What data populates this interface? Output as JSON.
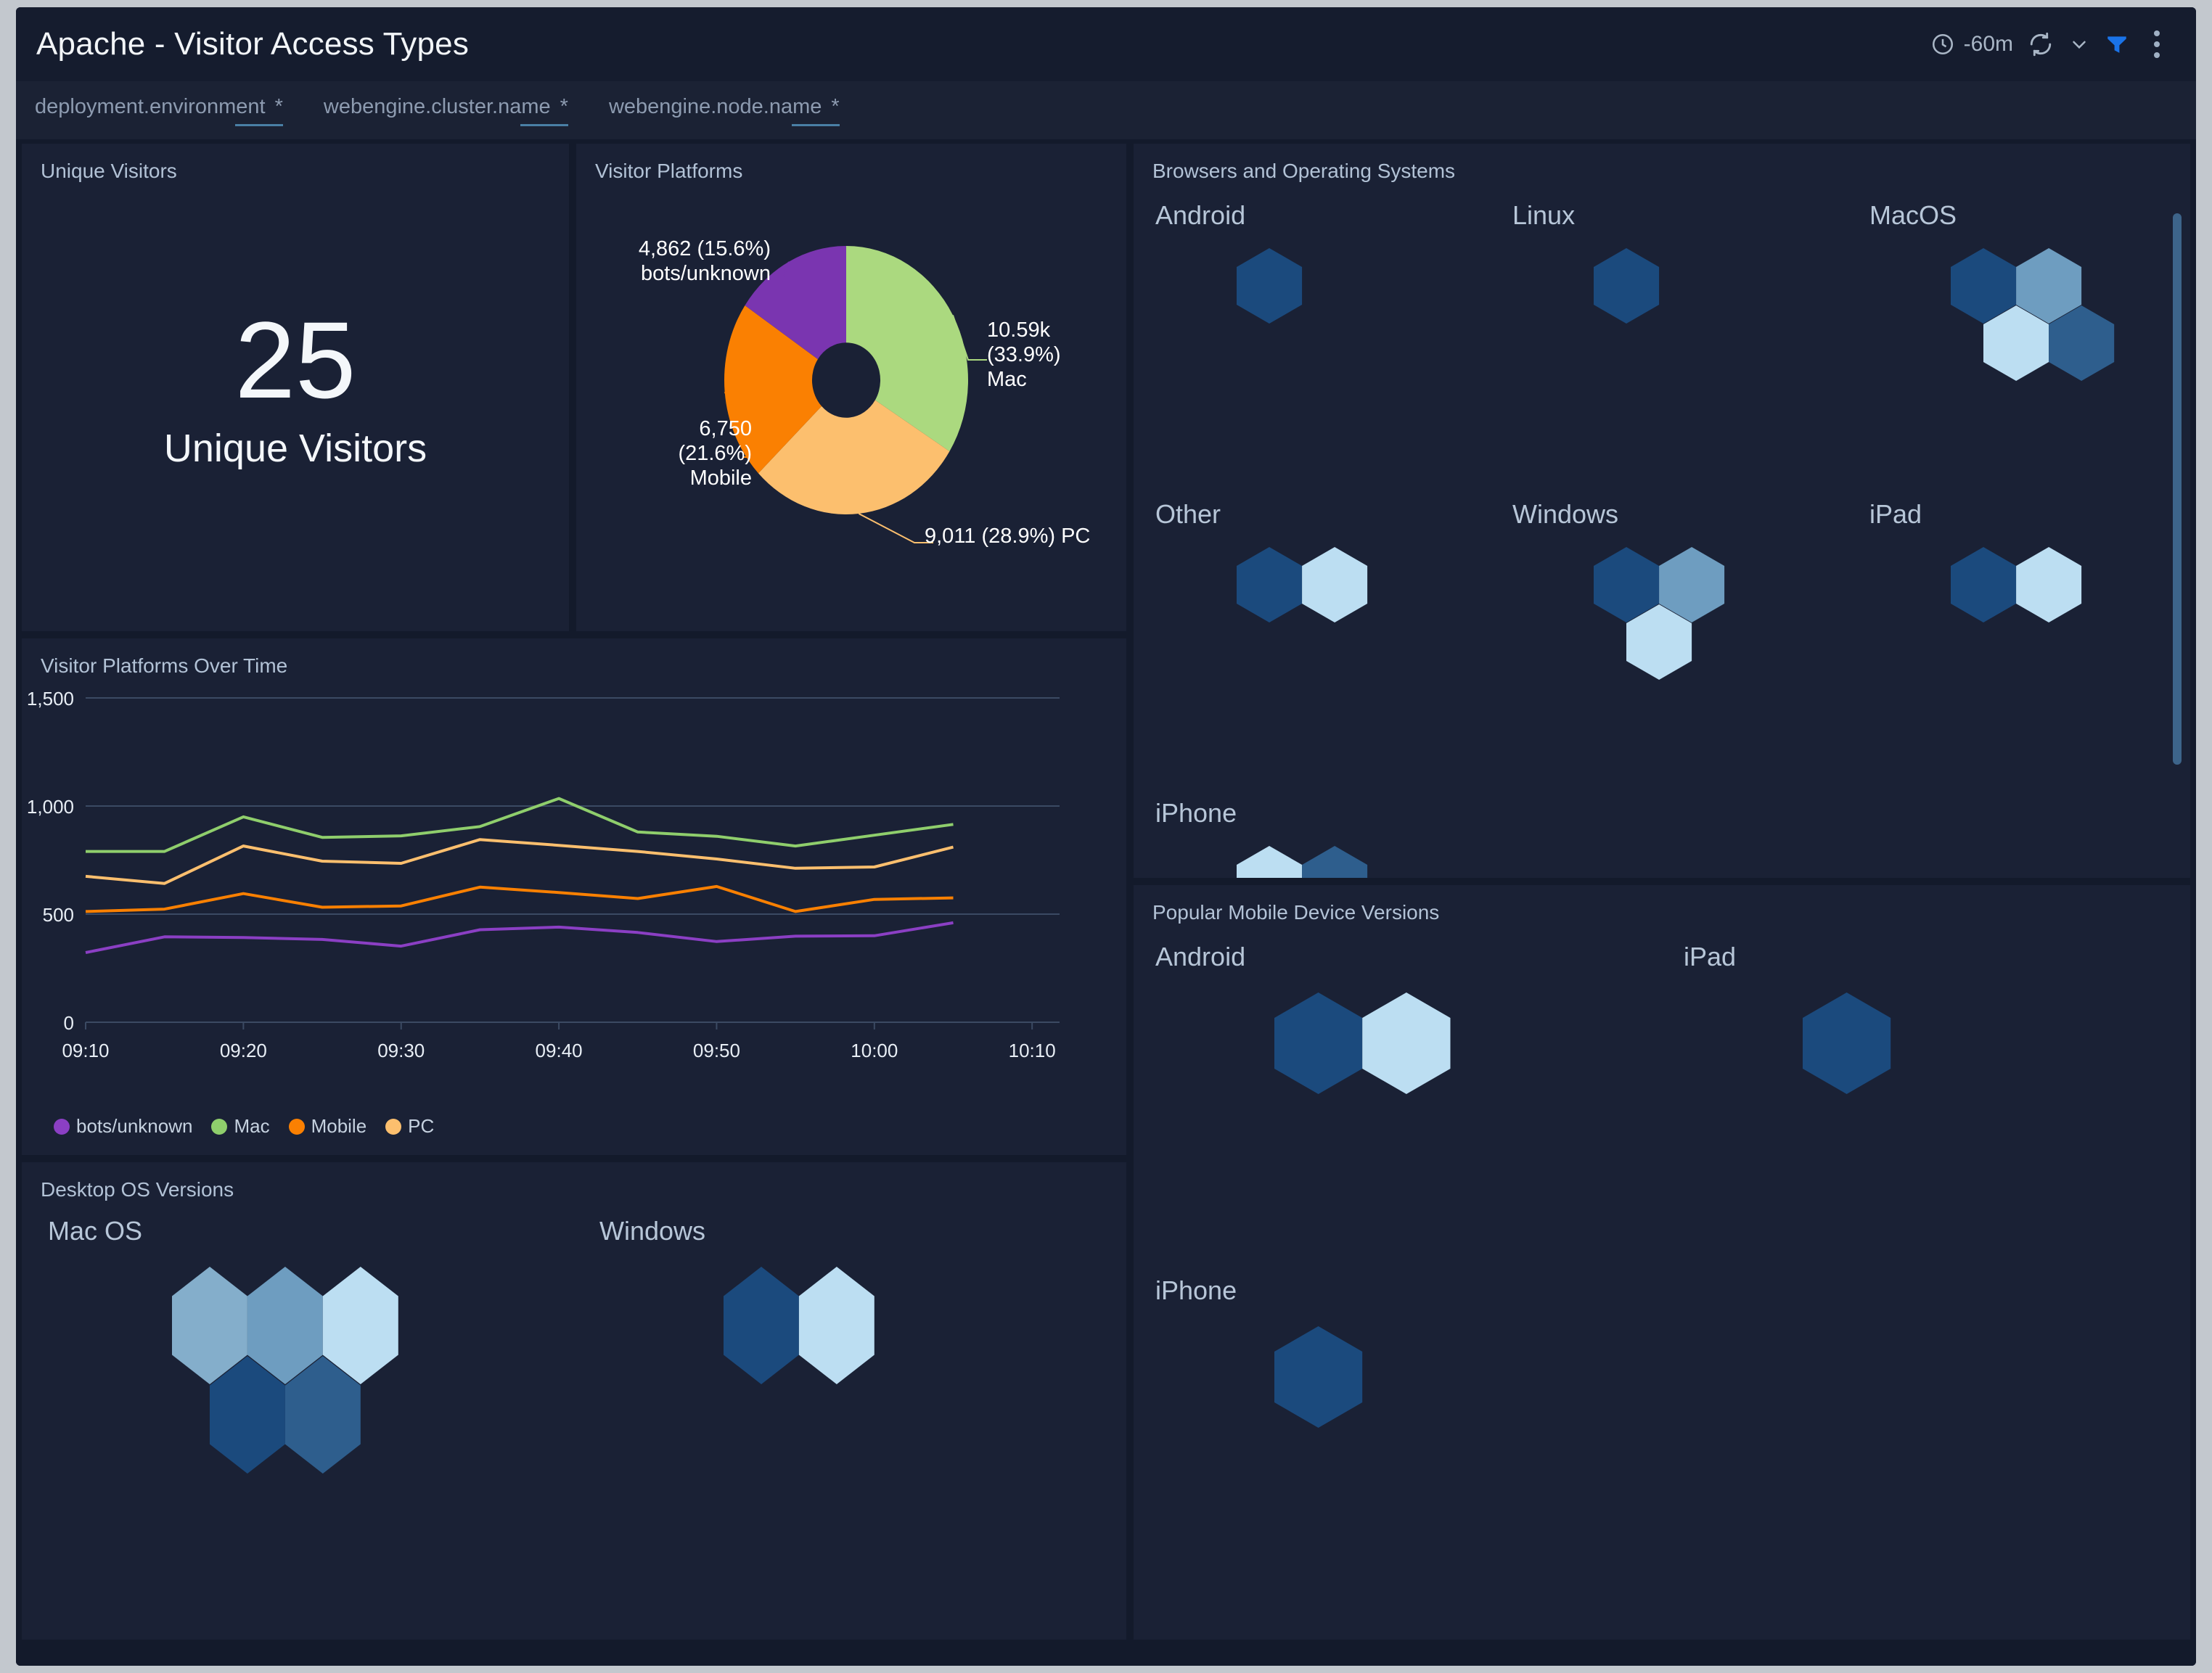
{
  "header": {
    "title": "Apache - Visitor Access Types",
    "time_range": "-60m",
    "icons": {
      "clock": "clock-icon",
      "refresh": "refresh-icon",
      "chevron": "chevron-down-icon",
      "filter": "filter-icon",
      "more": "more-vertical-icon"
    },
    "accent_color": "#1a73e8"
  },
  "filters": [
    {
      "label": "deployment.environment",
      "required_marker": "*",
      "value": ""
    },
    {
      "label": "webengine.cluster.name",
      "required_marker": "*",
      "value": ""
    },
    {
      "label": "webengine.node.name",
      "required_marker": "*",
      "value": ""
    }
  ],
  "panels": {
    "unique_visitors": {
      "title": "Unique Visitors",
      "value": "25",
      "label": "Unique Visitors"
    },
    "visitor_platforms": {
      "title": "Visitor Platforms"
    },
    "visitor_platforms_over_time": {
      "title": "Visitor Platforms Over Time"
    },
    "desktop_os_versions": {
      "title": "Desktop OS Versions"
    },
    "browsers_and_os": {
      "title": "Browsers and Operating Systems"
    },
    "popular_mobile_device_versions": {
      "title": "Popular Mobile Device Versions"
    }
  },
  "chart_data": [
    {
      "id": "visitor_platforms_pie",
      "type": "pie",
      "title": "Visitor Platforms",
      "donut": true,
      "legend": "labels-with-leader-lines",
      "slices": [
        {
          "label": "Mac",
          "value": 10590,
          "value_text": "10.59k",
          "percent": 33.9,
          "percent_text": "(33.9%)",
          "color": "#abd97f",
          "label_text": "10.59k\n(33.9%)\nMac"
        },
        {
          "label": "PC",
          "value": 9011,
          "value_text": "9,011",
          "percent": 28.9,
          "percent_text": "(28.9%)",
          "color": "#fcbf6e",
          "label_text": "9,011 (28.9%) PC"
        },
        {
          "label": "Mobile",
          "value": 6750,
          "value_text": "6,750",
          "percent": 21.6,
          "percent_text": "(21.6%)",
          "color": "#fa8002",
          "label_text": "6,750\n(21.6%)\nMobile"
        },
        {
          "label": "bots/unknown",
          "value": 4862,
          "value_text": "4,862",
          "percent": 15.6,
          "percent_text": "(15.6%)",
          "color": "#7a35b0",
          "label_text": "4,862 (15.6%)\nbots/unknown"
        }
      ]
    },
    {
      "id": "visitor_platforms_over_time",
      "type": "line",
      "title": "Visitor Platforms Over Time",
      "xlabel": "",
      "ylabel": "",
      "ylim": [
        0,
        1500
      ],
      "yticks": [
        0,
        500,
        1000,
        1500
      ],
      "ytick_labels": [
        "0",
        "500",
        "1,000",
        "1,500"
      ],
      "grid": true,
      "legend_position": "bottom-left",
      "xticks": [
        "09:10",
        "09:20",
        "09:30",
        "09:40",
        "09:50",
        "10:00",
        "10:10"
      ],
      "x": [
        "09:10",
        "09:15",
        "09:20",
        "09:25",
        "09:30",
        "09:35",
        "09:40",
        "09:45",
        "09:50",
        "09:55",
        "10:00",
        "10:05"
      ],
      "series": [
        {
          "name": "bots/unknown",
          "color": "#8b3fc4",
          "values": [
            322,
            395,
            392,
            383,
            352,
            428,
            440,
            415,
            373,
            398,
            400,
            460
          ]
        },
        {
          "name": "Mac",
          "color": "#8fce6c",
          "values": [
            790,
            790,
            950,
            855,
            862,
            905,
            1035,
            880,
            860,
            815,
            865,
            915
          ]
        },
        {
          "name": "Mobile",
          "color": "#fa8002",
          "values": [
            512,
            523,
            595,
            532,
            538,
            625,
            600,
            572,
            628,
            512,
            568,
            575
          ]
        },
        {
          "name": "PC",
          "color": "#fcbf6e",
          "values": [
            675,
            642,
            815,
            745,
            735,
            845,
            818,
            790,
            755,
            712,
            718,
            810
          ]
        }
      ]
    }
  ],
  "hex_colors": {
    "dark_navy": "#1b4a7d",
    "mid_dark": "#2e5e8d",
    "mid": "#6e9dc0",
    "mid_light": "#84aecb",
    "light": "#bcdef2"
  },
  "browsers_and_os": {
    "groups": [
      {
        "name": "Android",
        "hexes": [
          {
            "color": "#1b4a7d",
            "col": 0,
            "row": 0
          }
        ]
      },
      {
        "name": "Linux",
        "hexes": [
          {
            "color": "#1b4a7d",
            "col": 0,
            "row": 0
          }
        ]
      },
      {
        "name": "MacOS",
        "hexes": [
          {
            "color": "#1b4a7d",
            "col": 0,
            "row": 0
          },
          {
            "color": "#6e9dc0",
            "col": 1,
            "row": 0
          },
          {
            "color": "#bcdef2",
            "col": 0,
            "row": 1
          },
          {
            "color": "#2e5e8d",
            "col": 1,
            "row": 1
          }
        ]
      },
      {
        "name": "Other",
        "hexes": [
          {
            "color": "#1b4a7d",
            "col": 0,
            "row": 0
          },
          {
            "color": "#bcdef2",
            "col": 1,
            "row": 0
          }
        ]
      },
      {
        "name": "Windows",
        "hexes": [
          {
            "color": "#1b4a7d",
            "col": 0,
            "row": 0
          },
          {
            "color": "#6e9dc0",
            "col": 1,
            "row": 0
          },
          {
            "color": "#bcdef2",
            "col": 0,
            "row": 1
          }
        ]
      },
      {
        "name": "iPad",
        "hexes": [
          {
            "color": "#1b4a7d",
            "col": 0,
            "row": 0
          },
          {
            "color": "#bcdef2",
            "col": 1,
            "row": 0
          }
        ]
      },
      {
        "name": "iPhone",
        "hexes": [
          {
            "color": "#bcdef2",
            "col": 0,
            "row": 0
          },
          {
            "color": "#2e5e8d",
            "col": 1,
            "row": 0
          }
        ]
      }
    ]
  },
  "desktop_os_versions": {
    "groups": [
      {
        "name": "Mac OS",
        "hexes": [
          {
            "color": "#84aecb",
            "col": 0,
            "row": 0
          },
          {
            "color": "#6e9dc0",
            "col": 1,
            "row": 0
          },
          {
            "color": "#bcdef2",
            "col": 2,
            "row": 0
          },
          {
            "color": "#1b4a7d",
            "col": 0,
            "row": 1
          },
          {
            "color": "#2e5e8d",
            "col": 1,
            "row": 1
          }
        ]
      },
      {
        "name": "Windows",
        "hexes": [
          {
            "color": "#1b4a7d",
            "col": 0,
            "row": 0
          },
          {
            "color": "#bcdef2",
            "col": 1,
            "row": 0
          }
        ]
      }
    ]
  },
  "popular_mobile_device_versions": {
    "groups": [
      {
        "name": "Android",
        "hexes": [
          {
            "color": "#1b4a7d",
            "col": 0,
            "row": 0
          },
          {
            "color": "#bcdef2",
            "col": 1,
            "row": 0
          }
        ]
      },
      {
        "name": "iPad",
        "hexes": [
          {
            "color": "#1b4a7d",
            "col": 0,
            "row": 0
          }
        ]
      },
      {
        "name": "iPhone",
        "hexes": [
          {
            "color": "#1b4a7d",
            "col": 0,
            "row": 0
          }
        ]
      }
    ]
  }
}
